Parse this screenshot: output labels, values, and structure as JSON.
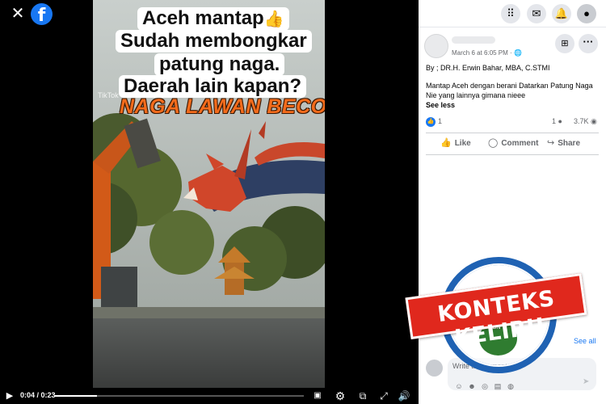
{
  "viewer": {
    "close_icon": "✕",
    "logo_letter": "f",
    "video": {
      "caption_lines": [
        "Aceh mantap",
        "Sudah membongkar",
        "patung naga.",
        "Daerah lain kapan?"
      ],
      "caption_emoji": "👍",
      "overlay_title": "NAGA LAWAN BECO",
      "watermark": "TikTok"
    },
    "controls": {
      "current_time": "0:04",
      "duration": "0:23",
      "progress": 0.17
    }
  },
  "topbar": {
    "icons": [
      "grid-icon",
      "messenger-icon",
      "bell-icon",
      "account-icon"
    ]
  },
  "post": {
    "date": "March 6 at 6:05 PM ·",
    "byline": "By ; DR.H. Erwin Bahar, MBA, C.STMI",
    "message": "Mantap Aceh dengan berani Datarkan Patung Naga Nie yang lainnya gimana nieee",
    "see_less": "See less",
    "like_count": "1",
    "comment_count": "1",
    "view_count": "3.7K",
    "actions": {
      "like": "Like",
      "comment": "Comment",
      "share": "Share"
    },
    "see_all": "See all",
    "comment_placeholder": "Write a comment…"
  },
  "stamp": {
    "label": "KONTEKS KELIRU",
    "logo_text": "TBN",
    "colors": {
      "banner": "#e0281d",
      "ring": "#1f62b3",
      "logo": "#2f7c30"
    }
  }
}
